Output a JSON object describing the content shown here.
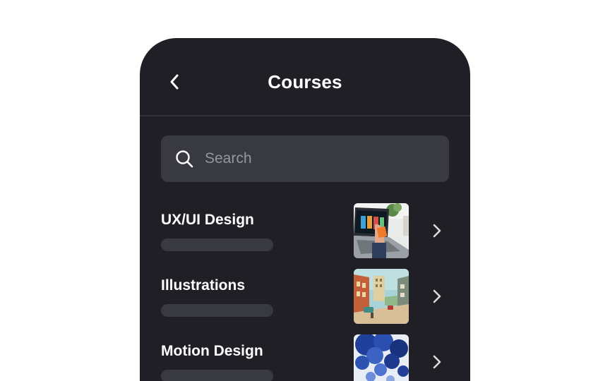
{
  "header": {
    "title": "Courses",
    "back_icon": "chevron-left-icon"
  },
  "search": {
    "placeholder": "Search",
    "value": "",
    "icon": "search-icon"
  },
  "courses": [
    {
      "name": "UX/UI Design",
      "thumbnail": "laptop-photo",
      "icon": "chevron-right-icon"
    },
    {
      "name": "Illustrations",
      "thumbnail": "city-street-painting",
      "icon": "chevron-right-icon"
    },
    {
      "name": "Motion Design",
      "thumbnail": "blue-ink-cloud",
      "icon": "chevron-right-icon"
    }
  ],
  "colors": {
    "background": "#ffffff",
    "phone": "#1f1f25",
    "surface": "#393941",
    "divider": "#33343b",
    "text": "#ffffff",
    "placeholder": "#96969e"
  }
}
